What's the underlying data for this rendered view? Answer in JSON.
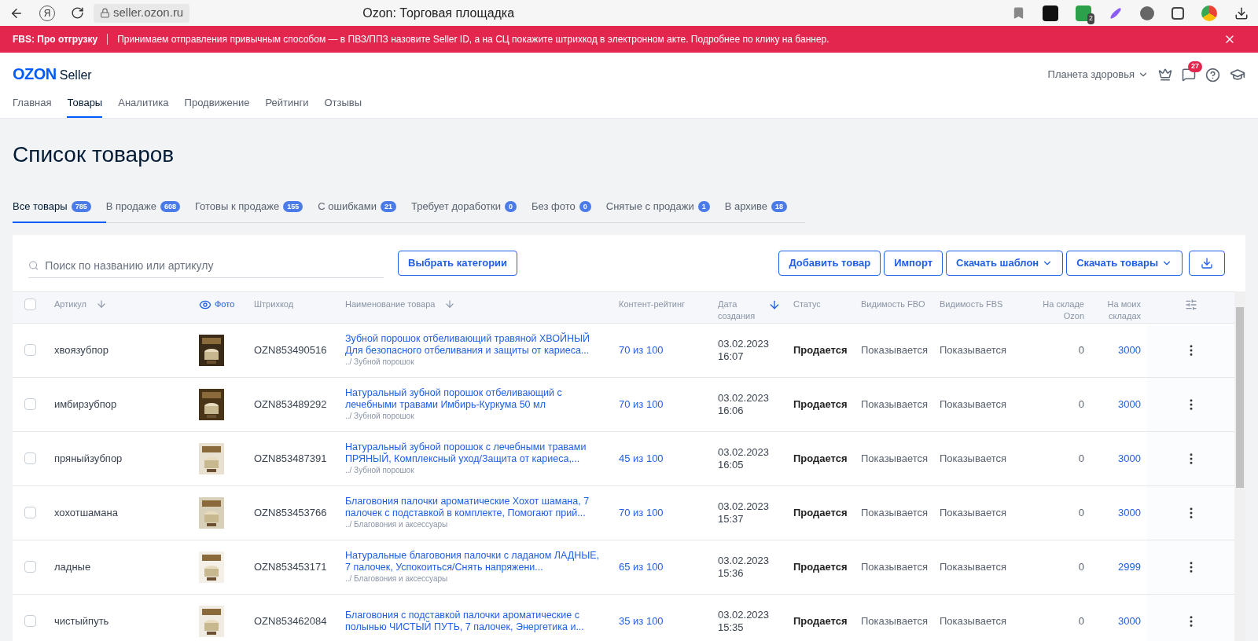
{
  "browser": {
    "logo": "Я",
    "url": "seller.ozon.ru",
    "title": "Ozon: Торговая площадка",
    "extension_badge": "2"
  },
  "banner": {
    "label": "FBS: Про отгрузку",
    "message": "Принимаем отправления привычным способом — в ПВЗ/ППЗ назовите Seller ID, а на СЦ покажите штрихкод в электронном акте. Подробнее по клику на баннер."
  },
  "header": {
    "logo_brand": "OZON",
    "logo_product": "Seller",
    "shop": "Планета здоровья",
    "chat_badge": "27"
  },
  "nav": [
    {
      "label": "Главная",
      "selected": false
    },
    {
      "label": "Товары",
      "selected": true
    },
    {
      "label": "Аналитика",
      "selected": false
    },
    {
      "label": "Продвижение",
      "selected": false
    },
    {
      "label": "Рейтинги",
      "selected": false
    },
    {
      "label": "Отзывы",
      "selected": false
    }
  ],
  "page_title": "Список товаров",
  "tabs": [
    {
      "label": "Все товары",
      "count": "785",
      "selected": true
    },
    {
      "label": "В продаже",
      "count": "608",
      "selected": false
    },
    {
      "label": "Готовы к продаже",
      "count": "155",
      "selected": false
    },
    {
      "label": "С ошибками",
      "count": "21",
      "selected": false
    },
    {
      "label": "Требует доработки",
      "count": "0",
      "selected": false
    },
    {
      "label": "Без фото",
      "count": "0",
      "selected": false
    },
    {
      "label": "Снятые с продажи",
      "count": "1",
      "selected": false
    },
    {
      "label": "В архиве",
      "count": "18",
      "selected": false
    }
  ],
  "search": {
    "placeholder": "Поиск по названию или артикулу"
  },
  "category_button": "Выбрать категории",
  "actions": [
    {
      "kind": "button",
      "label": "Добавить товар"
    },
    {
      "kind": "button",
      "label": "Импорт"
    },
    {
      "kind": "dropdown",
      "label": "Скачать шаблон"
    },
    {
      "kind": "dropdown",
      "label": "Скачать товары"
    },
    {
      "kind": "icon"
    }
  ],
  "table": {
    "all_checked": false,
    "columns": [
      {
        "kind": "sortable",
        "label": "Артикул"
      },
      {
        "label": "Фото"
      },
      {
        "kind": "text",
        "label": "Штрихкод"
      },
      {
        "kind": "sortable",
        "label": "Наименование товара"
      },
      {
        "kind": "text",
        "label": "Контент-рейтинг"
      },
      {
        "kind": "sorted",
        "label": "Дата создания"
      },
      {
        "kind": "text",
        "label": "Статус"
      },
      {
        "kind": "text",
        "label": "Видимость FBO"
      },
      {
        "kind": "text",
        "label": "Видимость FBS"
      },
      {
        "kind": "number",
        "label": "На складе Ozon"
      },
      {
        "kind": "number",
        "label": "На моих складах"
      }
    ],
    "rows": [
      {
        "checked": false,
        "article": "хвоязубпор",
        "barcode": "OZN853490516",
        "name": "Зубной порошок отбеливающий травяной ХВОЙНЫЙ Для безопасного отбеливания и защиты от кариеса...",
        "category": "../ Зубной порошок",
        "rating": "70 из 100",
        "date": "03.02.2023",
        "time": "16:07",
        "status": "Продается",
        "fbo": "Показывается",
        "fbs": "Показывается",
        "ozon_stock": "0",
        "my_stock": "3000"
      },
      {
        "checked": false,
        "article": "имбирзубпор",
        "barcode": "OZN853489292",
        "name": "Натуральный зубной порошок отбеливающий с лечебными травами Имбирь-Куркума 50 мл",
        "category": "../ Зубной порошок",
        "rating": "70 из 100",
        "date": "03.02.2023",
        "time": "16:06",
        "status": "Продается",
        "fbo": "Показывается",
        "fbs": "Показывается",
        "ozon_stock": "0",
        "my_stock": "3000"
      },
      {
        "checked": false,
        "article": "пряныйзубпор",
        "barcode": "OZN853487391",
        "name": "Натуральный зубной порошок с лечебными травами ПРЯНЫЙ, Комплексный уход/Защита от кариеса,...",
        "category": "../ Зубной порошок",
        "rating": "45 из 100",
        "date": "03.02.2023",
        "time": "16:05",
        "status": "Продается",
        "fbo": "Показывается",
        "fbs": "Показывается",
        "ozon_stock": "0",
        "my_stock": "3000"
      },
      {
        "checked": false,
        "article": "хохотшамана",
        "barcode": "OZN853453766",
        "name": "Благовония палочки ароматические Хохот шамана, 7 палочек с подставкой в комплекте, Помогают прий...",
        "category": "../ Благовония и аксессуары",
        "rating": "70 из 100",
        "date": "03.02.2023",
        "time": "15:37",
        "status": "Продается",
        "fbo": "Показывается",
        "fbs": "Показывается",
        "ozon_stock": "0",
        "my_stock": "3000"
      },
      {
        "checked": false,
        "article": "ладные",
        "barcode": "OZN853453171",
        "name": "Натуральные благовония палочки с ладаном ЛАДНЫЕ, 7 палочек, Успокоиться/Снять напряжени...",
        "category": "../ Благовония и аксессуары",
        "rating": "65 из 100",
        "date": "03.02.2023",
        "time": "15:36",
        "status": "Продается",
        "fbo": "Показывается",
        "fbs": "Показывается",
        "ozon_stock": "0",
        "my_stock": "2999"
      },
      {
        "checked": false,
        "article": "чистыйпуть",
        "barcode": "OZN853462084",
        "name": "Благовония с подставкой палочки ароматические с полынью ЧИСТЫЙ ПУТЬ, 7 палочек, Энергетика и...",
        "rating": "35 из 100",
        "date": "03.02.2023",
        "time": "15:35",
        "status": "Продается",
        "fbo": "Показывается",
        "fbs": "Показывается",
        "ozon_stock": "0",
        "my_stock": "3000"
      }
    ]
  }
}
